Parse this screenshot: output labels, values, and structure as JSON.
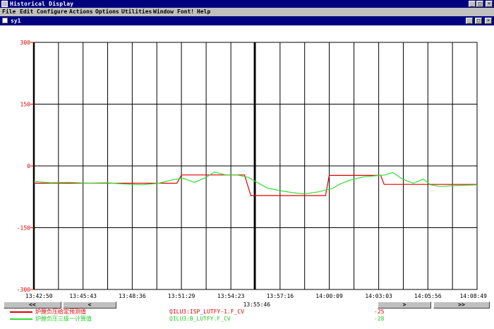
{
  "window": {
    "title": "Historical Display",
    "controls": {
      "minimize": "_",
      "maximize": "□",
      "close": "×"
    }
  },
  "menu": [
    "File",
    "Edit",
    "Configure",
    "Actions",
    "Options",
    "Utilities",
    "Window",
    "Font!",
    "Help"
  ],
  "subwindow": {
    "title": "sy1"
  },
  "colors": {
    "red_series": "#e00000",
    "green_series": "#33dd33",
    "grid": "#000000"
  },
  "chart_data": {
    "type": "line",
    "xlabel": "",
    "ylabel": "",
    "ylim": [
      -300,
      300
    ],
    "yticks": [
      "300",
      "150",
      "0",
      "-150",
      "-300"
    ],
    "x_ticks": [
      "13:42:50",
      "13:45:43",
      "13:48:36",
      "13:51:29",
      "13:54:23",
      "13:57:16",
      "14:00:09",
      "14:03:03",
      "14:05:56",
      "14:08:49"
    ],
    "cursor_time": "13:55:46",
    "grid": true,
    "series": [
      {
        "name": "炉膛负压给定预测值",
        "tag": "QILU3:ISP_LUTFY-1.F_CV",
        "current": "-25",
        "color": "#e00000",
        "points": [
          [
            "13:42:50",
            -42
          ],
          [
            "13:51:13",
            -42
          ],
          [
            "13:51:29",
            -22
          ],
          [
            "13:55:11",
            -22
          ],
          [
            "13:55:33",
            -72
          ],
          [
            "13:59:56",
            -72
          ],
          [
            "14:00:09",
            -23
          ],
          [
            "14:03:10",
            -23
          ],
          [
            "14:03:22",
            -45
          ],
          [
            "14:08:49",
            -45
          ]
        ]
      },
      {
        "name": "炉膛负压三级一计算值",
        "tag": "QILU3:B_LUTFY.F_CV",
        "current": "-28",
        "color": "#33dd33",
        "points": [
          [
            "13:42:50",
            -38
          ],
          [
            "13:43:50",
            -41
          ],
          [
            "13:44:55",
            -40
          ],
          [
            "13:46:00",
            -42
          ],
          [
            "13:47:05",
            -41
          ],
          [
            "13:48:10",
            -44
          ],
          [
            "13:49:10",
            -46
          ],
          [
            "13:50:10",
            -42
          ],
          [
            "13:50:56",
            -34
          ],
          [
            "13:51:35",
            -30
          ],
          [
            "13:52:15",
            -40
          ],
          [
            "13:52:55",
            -28
          ],
          [
            "13:53:25",
            -15
          ],
          [
            "13:54:05",
            -22
          ],
          [
            "13:54:45",
            -22
          ],
          [
            "13:55:25",
            -28
          ],
          [
            "13:55:55",
            -40
          ],
          [
            "13:56:32",
            -54
          ],
          [
            "13:57:16",
            -60
          ],
          [
            "13:58:00",
            -65
          ],
          [
            "13:58:40",
            -68
          ],
          [
            "13:59:30",
            -63
          ],
          [
            "14:00:00",
            -58
          ],
          [
            "14:00:20",
            -55
          ],
          [
            "14:00:44",
            -45
          ],
          [
            "14:01:20",
            -35
          ],
          [
            "14:02:05",
            -27
          ],
          [
            "14:02:50",
            -24
          ],
          [
            "14:03:26",
            -22
          ],
          [
            "14:03:52",
            -16
          ],
          [
            "14:04:27",
            -32
          ],
          [
            "14:05:05",
            -42
          ],
          [
            "14:05:40",
            -32
          ],
          [
            "14:06:05",
            -46
          ],
          [
            "14:06:40",
            -50
          ],
          [
            "14:07:20",
            -48
          ],
          [
            "14:08:49",
            -46
          ]
        ]
      }
    ]
  },
  "nav": {
    "fast_back": "<<",
    "back": "<",
    "forward": ">",
    "fast_forward": ">>"
  }
}
